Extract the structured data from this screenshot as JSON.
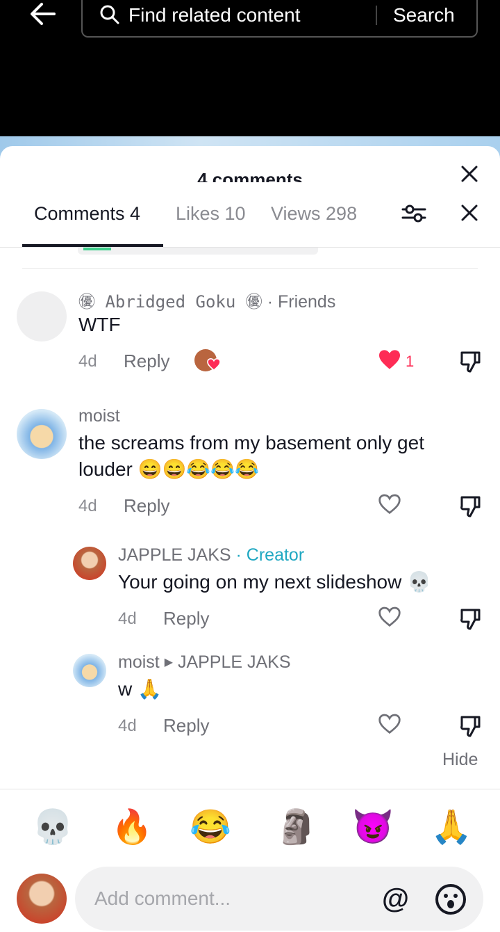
{
  "header": {
    "search_placeholder": "Find related content",
    "search_button": "Search"
  },
  "sheet": {
    "title": "4 comments",
    "tabs": [
      {
        "label": "Comments 4"
      },
      {
        "label": "Likes 10"
      },
      {
        "label": "Views 298"
      }
    ]
  },
  "comments": [
    {
      "user": "㊝ Abridged Goku ㊝",
      "tag": "· Friends",
      "text": "WTF",
      "time": "4d",
      "reply": "Reply",
      "likes": "1"
    },
    {
      "user": "moist",
      "text": "the screams from my basement only get louder 😄😄😂😂😂",
      "time": "4d",
      "reply": "Reply"
    }
  ],
  "replies": [
    {
      "user": "JAPPLE JAKS",
      "tag": "· Creator",
      "text": "Your going on my next slideshow 💀",
      "time": "4d",
      "reply": "Reply"
    },
    {
      "user": "moist",
      "reply_to": "JAPPLE JAKS",
      "text": "w 🙏",
      "time": "4d",
      "reply": "Reply"
    }
  ],
  "hide_label": "Hide",
  "quick_emojis": [
    "💀",
    "🔥",
    "😂",
    "🗿",
    "😈",
    "🙏"
  ],
  "composer": {
    "placeholder": "Add comment...",
    "at_symbol": "@"
  },
  "colors": {
    "like_red": "#fe2c55",
    "creator_teal": "#20a8c2",
    "text_primary": "#161823",
    "text_secondary": "#8a8b91"
  }
}
